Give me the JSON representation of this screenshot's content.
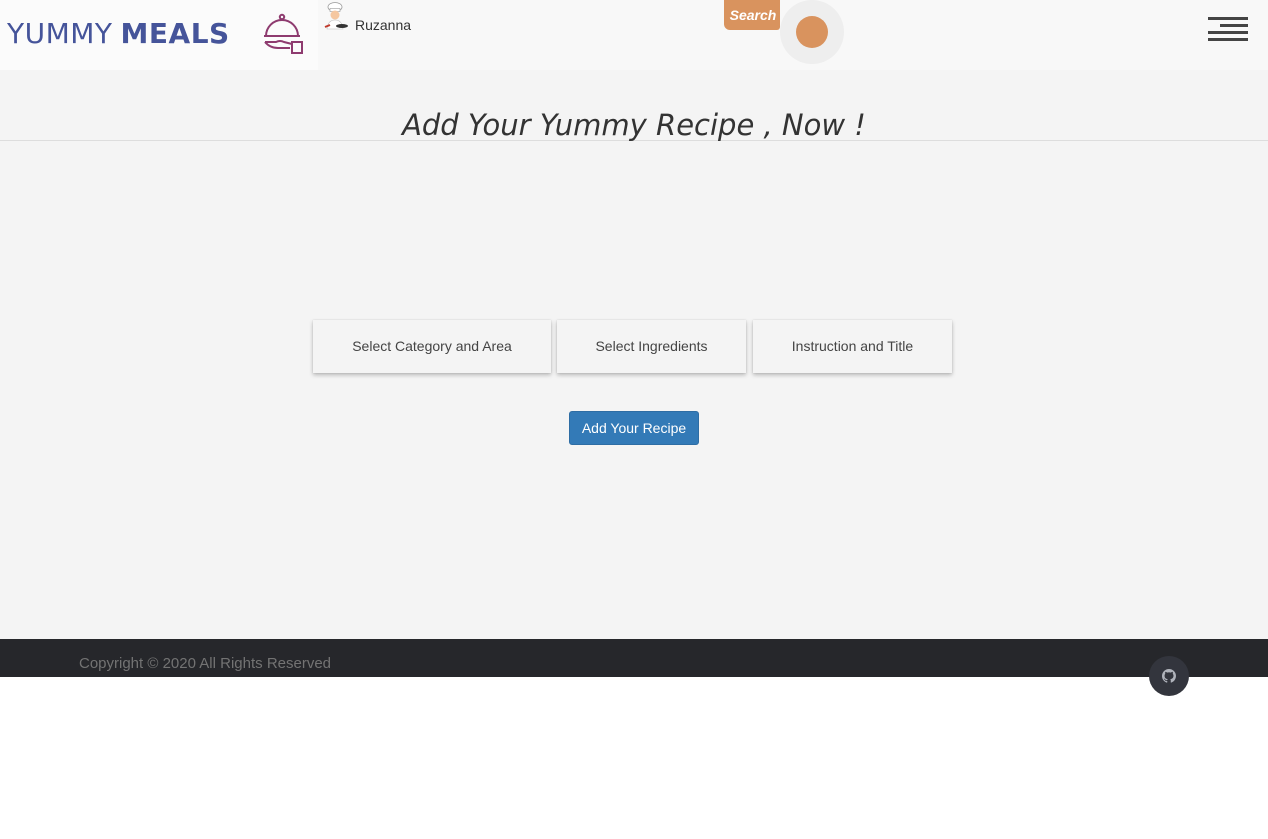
{
  "header": {
    "logo_word_1": "YUMMY",
    "logo_word_2": "MEALS",
    "username": "Ruzanna",
    "search_label": "Search"
  },
  "main": {
    "title": "Add Your Yummy Recipe , Now !",
    "steps": [
      {
        "label": "Select Category and Area"
      },
      {
        "label": "Select Ingredients"
      },
      {
        "label": "Instruction and Title"
      }
    ],
    "submit_label": "Add Your Recipe"
  },
  "footer": {
    "copyright": "Copyright © 2020 All Rights Reserved"
  },
  "icons": {
    "logo": "serving-cloche-icon",
    "avatar": "chef-avatar-icon",
    "menu": "hamburger-menu-icon",
    "social": "github-icon"
  },
  "colors": {
    "brand": "#45549a",
    "accent": "#d9935e",
    "primary_button": "#337ab7",
    "footer_bg": "#26272b"
  }
}
